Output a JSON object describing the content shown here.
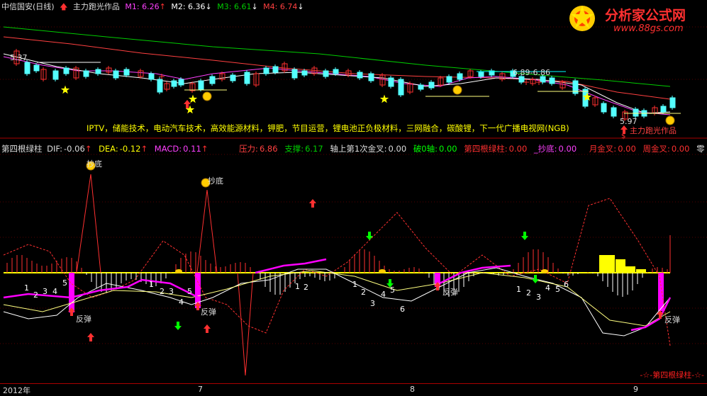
{
  "top_header": {
    "stock": "中信国安(日线)",
    "author": "主力跑光作品",
    "m1_label": "M1:",
    "m1_value": "6.26",
    "m2_label": "M2:",
    "m2_value": "6.36",
    "m3_label": "M3:",
    "m3_value": "6.61",
    "m4_label": "M4:",
    "m4_value": "6.74",
    "colors": {
      "m1": "#ff40ff",
      "m2": "#ffffff",
      "m3": "#00cc00",
      "m4": "#ff4040"
    }
  },
  "logo": {
    "brand": "分析家公式网",
    "url": "www.88gs.com",
    "icon": "star-flower-icon"
  },
  "price_labels": {
    "high_label": "5.37",
    "range_label": "6.89-6.86",
    "low_label": "5.97",
    "author_tag": "主力跑光作品",
    "dollar": "$"
  },
  "concepts": "IPTV，储能技术，电动汽车技术，高效能源材料，钾肥，节目运营，锂电池正负极材料，三网融合，碳酸锂，下一代广播电视网(NGB)",
  "bottom_header": {
    "indicator": "第四根绿柱",
    "dif_label": "DIF:",
    "dif_value": "-0.06",
    "dea_label": "DEA:",
    "dea_value": "-0.12",
    "macd_label": "MACD:",
    "macd_value": "0.11",
    "pressure_label": "压力:",
    "pressure_value": "6.86",
    "support_label": "支撑:",
    "support_value": "6.17",
    "axis_gold_label": "轴上第1次金叉:",
    "axis_gold_value": "0.00",
    "break0_label": "破0轴:",
    "break0_value": "0.00",
    "fourth_label": "第四根绿柱:",
    "fourth_value": "0.00",
    "chaodi_label": "_抄底:",
    "chaodi_value": "0.00",
    "monthgold_label": "月金叉:",
    "monthgold_value": "0.00",
    "weekgold_label": "周金叉:",
    "weekgold_value": "0.00",
    "zero_label": "零"
  },
  "annotations": {
    "chaodi": "抄底",
    "fantan": "反弹",
    "tag": "-☆-第四根绿柱-☆-"
  },
  "x_axis": {
    "labels": [
      "2012年",
      "7",
      "8",
      "9"
    ]
  },
  "chart_data": [
    {
      "type": "candlestick",
      "title": "中信国安(日线)",
      "series": [
        {
          "name": "M1",
          "value": 6.26
        },
        {
          "name": "M2",
          "value": 6.36
        },
        {
          "name": "M3",
          "value": 6.61
        },
        {
          "name": "M4",
          "value": 6.74
        }
      ]
    },
    {
      "type": "bar",
      "title": "第四根绿柱",
      "series": [
        {
          "name": "DIF",
          "value": -0.06
        },
        {
          "name": "DEA",
          "value": -0.12
        },
        {
          "name": "MACD",
          "value": 0.11
        }
      ]
    }
  ]
}
